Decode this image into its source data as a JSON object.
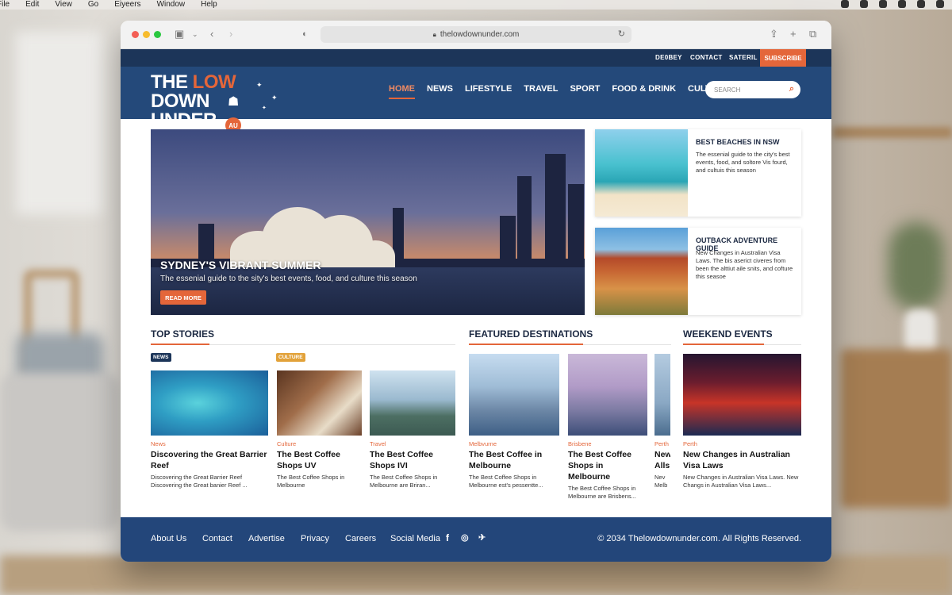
{
  "menubar": {
    "items": [
      "File",
      "Edit",
      "View",
      "Go",
      "Eiyeers",
      "Window",
      "Help"
    ]
  },
  "browser": {
    "url": "thelowdownunder.com"
  },
  "site": {
    "top_links": [
      "DE0BEY",
      "CONTACT",
      "SATERIL"
    ],
    "subscribe": "SUBSCRIBE",
    "logo": {
      "line1a": "THE ",
      "line1b": "LOW",
      "line2": "DOWN",
      "line3": "UNDER",
      "badge": "AU"
    },
    "nav": [
      "HOME",
      "NEWS",
      "LIFESTYLE",
      "TRAVEL",
      "SPORT",
      "FOOD & DRINK",
      "CULTURE"
    ],
    "search_placeholder": "SEARCH"
  },
  "hero": {
    "title": "SYDNEY'S VIBRANT SUMMER",
    "subtitle": "The essenial guide to the sity's best events, food, and culture this season",
    "button": "READ MORE"
  },
  "side_cards": [
    {
      "title": "BEST BEACHES IN NSW",
      "desc": "The essenial guide to the city's best events, food, and soltore Vis fourd, and cultuis this season"
    },
    {
      "title": "OUTBACK ADVENTURE GUIDE",
      "desc": "New Changes in Australian Visa Laws. The bis aserict civeres from been the alttiut aile snits, and cofture this seasoe"
    }
  ],
  "sections": {
    "top_stories": "TOP STORIES",
    "featured": "FEATURED DESTINATIONS",
    "weekend": "WEEKEND EVENTS"
  },
  "badges": {
    "news": "NEWS",
    "culture": "CULTURE"
  },
  "cards": [
    {
      "category": "News",
      "title": "Discovering the Great Barrier Reef",
      "desc": "Discovering the Great Barrier Reef Discovering the Great banier Reef ..."
    },
    {
      "category": "Culture",
      "title": "The Best Coffee Shops UV",
      "desc": "The Best Coffee Shops in Melbourne"
    },
    {
      "category": "Travel",
      "title": "The Best Coffee Shops IVI",
      "desc": "The Best Coffee Shops in Melbourne are Briran..."
    },
    {
      "category": "Melbvurne",
      "title": "The Best Coffee in Melbourne",
      "desc": "The Best Coffee Shops in Melbourne est's pessentte..."
    },
    {
      "category": "Brisbene",
      "title": "The Best Coffee Shops in Melbourne",
      "desc": "The Best Coffee Shops in Melbourne are Brisbens..."
    },
    {
      "category": "Perth",
      "title": "New Alls",
      "desc": "Nev Melb"
    },
    {
      "category": "Perth",
      "title": "New Changes in Australian Visa Laws",
      "desc": "New Changes in Australian Visa Laws. New Changs in Australian Visa Laws..."
    }
  ],
  "footer": {
    "links": [
      "About Us",
      "Contact",
      "Advertise",
      "Privacy",
      "Careers",
      "Social Media"
    ],
    "copyright": "© 2034 Thelowdownunder.com. All Rights Reserved."
  },
  "colors": {
    "accent": "#e4663a",
    "navy": "#24497a",
    "dark_navy": "#1c3559"
  },
  "icons": [
    "sidebar-icon",
    "back-icon",
    "forward-icon",
    "shield-icon",
    "lock-icon",
    "reload-icon",
    "share-icon",
    "new-tab-icon",
    "tabs-icon",
    "search-icon",
    "facebook-icon",
    "instagram-icon",
    "twitter-icon"
  ]
}
